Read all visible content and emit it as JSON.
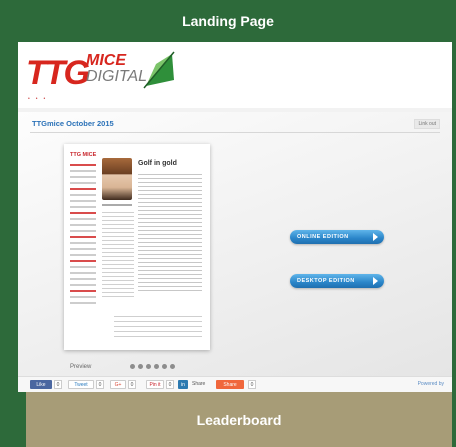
{
  "header": {
    "title": "Landing Page"
  },
  "logo": {
    "ttg": "TTG",
    "mice": "MICE",
    "digital": "DIGITAL"
  },
  "viewer": {
    "title": "TTGmice October 2015",
    "top_link": "Link out",
    "document": {
      "headline": "Golf in gold"
    },
    "online_button": "ONLINE EDITION",
    "desktop_button": "DESKTOP EDITION",
    "preview_label": "Preview",
    "preview_dot_count": 6
  },
  "share_bar": {
    "like": "Like",
    "count": "0",
    "tweet": "Tweet",
    "gplus": "G+",
    "pin": "Pin it",
    "linkedin": "in",
    "share_label": "Share",
    "orange": "Share",
    "powered": "Powered by"
  },
  "leaderboard": {
    "title": "Leaderboard"
  },
  "colors": {
    "background": "#2d6a3a",
    "leaderboard": "#a79c77",
    "accent_blue": "#2b72b8",
    "logo_red": "#d7261e"
  }
}
